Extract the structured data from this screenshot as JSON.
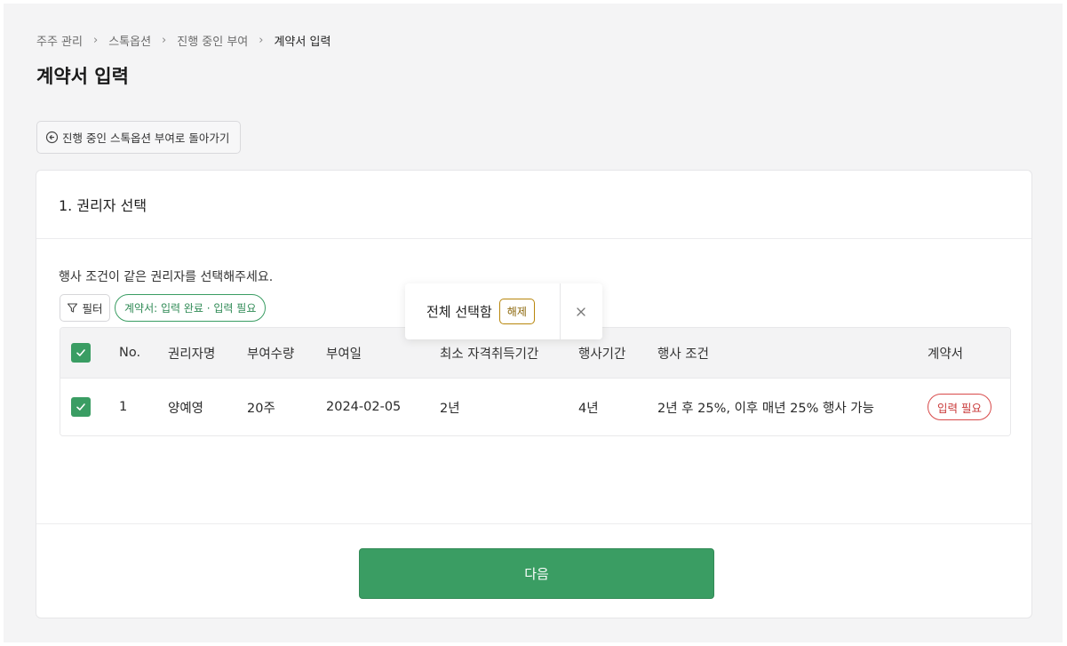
{
  "breadcrumb": {
    "items": [
      "주주 관리",
      "스톡옵션",
      "진행 중인 부여",
      "계약서 입력"
    ],
    "separator": "›"
  },
  "page_title": "계약서 입력",
  "back_button": {
    "label": "진행 중인 스톡옵션 부여로 돌아가기",
    "icon": "circle-arrow-left-icon"
  },
  "section": {
    "title": "1. 권리자 선택",
    "instruction": "행사 조건이 같은 권리자를 선택해주세요.",
    "filter_button": {
      "label": "필터",
      "icon": "filter-icon"
    },
    "filter_chip": {
      "label": "계약서: 입력 완료 · 입력 필요"
    }
  },
  "table": {
    "headers": {
      "no": "No.",
      "holder_name": "권리자명",
      "grant_quantity": "부여수량",
      "grant_date": "부여일",
      "min_vesting": "최소 자격취득기간",
      "exercise_period": "행사기간",
      "exercise_condition": "행사 조건",
      "contract": "계약서"
    },
    "header_checked": true,
    "rows": [
      {
        "checked": true,
        "no": "1",
        "holder_name": "양예영",
        "grant_quantity": "20주",
        "grant_date": "2024-02-05",
        "min_vesting": "2년",
        "exercise_period": "4년",
        "exercise_condition": "2년 후 25%, 이후 매년 25% 행사 가능",
        "contract_status": "입력 필요"
      }
    ]
  },
  "selection_bar": {
    "text": "전체 선택함",
    "release_label": "해제",
    "close_icon": "close-icon"
  },
  "next_button": {
    "label": "다음"
  },
  "colors": {
    "primary_green": "#3a9d63",
    "danger_red": "#d84a4a",
    "release_gold": "#b8860b",
    "background": "#f4f4f5"
  }
}
